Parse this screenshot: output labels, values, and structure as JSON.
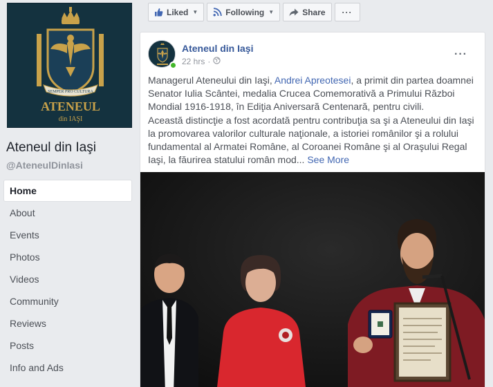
{
  "page": {
    "logo": {
      "name_line1": "ATENEUL",
      "name_line2": "din IAŞI",
      "motto": "SEMPER PRO CULTURA"
    },
    "name": "Ateneul din Iaşi",
    "handle": "@AteneulDinIasi"
  },
  "nav": {
    "items": [
      {
        "label": "Home",
        "active": true
      },
      {
        "label": "About"
      },
      {
        "label": "Events"
      },
      {
        "label": "Photos"
      },
      {
        "label": "Videos"
      },
      {
        "label": "Community"
      },
      {
        "label": "Reviews"
      },
      {
        "label": "Posts"
      },
      {
        "label": "Info and Ads"
      }
    ]
  },
  "actions": {
    "liked": "Liked",
    "following": "Following",
    "share": "Share",
    "more": "···"
  },
  "post": {
    "author": "Ateneul din Iaşi",
    "time": "22 hrs",
    "privacy_icon": "globe-icon",
    "text_1": "Managerul Ateneului din Iaşi, ",
    "mention": "Andrei Apreotesei",
    "text_2": ", a primit din partea doamnei Senator Iulia Scântei, medalia Crucea Comemorativă a Primului Război Mondial 1916-1918, în Ediţia Aniversară Centenară, pentru civili.",
    "text_3": "Această distincţie a fost acordată pentru contribuţia sa şi a Ateneului din Iaşi la promovarea valorilor culturale naţionale, a istoriei românilor şi a rolului fundamental al Armatei Române, al Coroanei Române şi al Oraşului Regal Iaşi, la făurirea statului român mod...",
    "see_more": "See More",
    "menu": "···"
  },
  "colors": {
    "link": "#365899",
    "background": "#e9ebee",
    "online": "#42b72a",
    "logo_bg": "#14323f",
    "gold": "#c9a24a"
  }
}
